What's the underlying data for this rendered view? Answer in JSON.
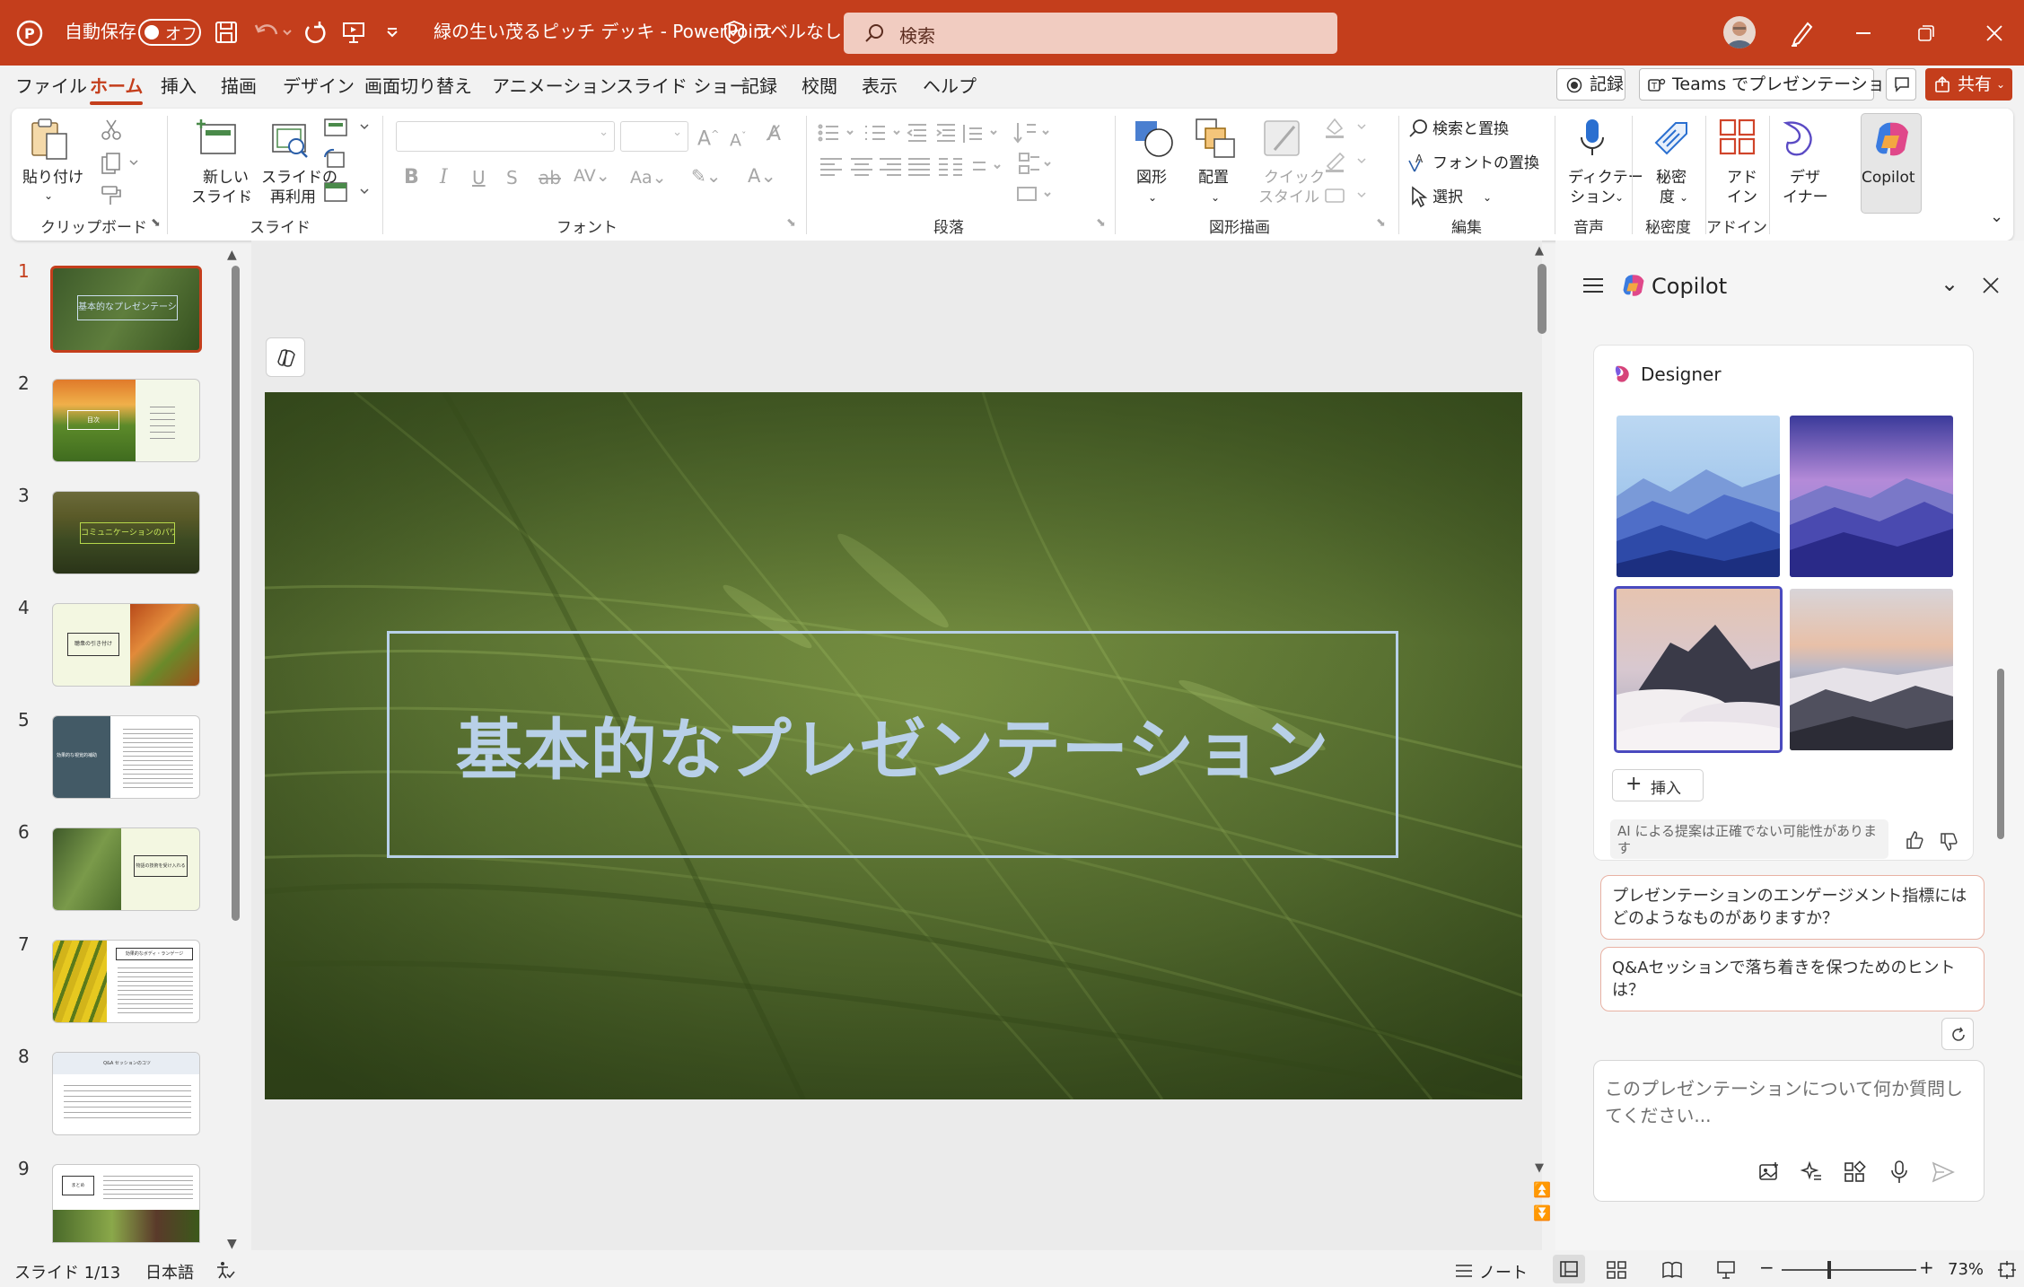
{
  "colors": {
    "accent": "#c43e1c",
    "title_text": "#b8d0e8",
    "focus": "#4a4abf"
  },
  "titlebar": {
    "autosave_label": "自動保存",
    "autosave_state": "オフ",
    "document_title": "緑の生い茂るピッチ デッキ  -  PowerPoint",
    "sensitivity_label": "ラベルなし",
    "search_placeholder": "検索"
  },
  "menu": {
    "tabs": [
      "ファイル",
      "ホーム",
      "挿入",
      "描画",
      "デザイン",
      "画面切り替え",
      "アニメーション",
      "スライド ショー",
      "記録",
      "校閲",
      "表示",
      "ヘルプ"
    ],
    "active_tab": "ホーム",
    "record_button": "記録",
    "teams_button": "Teams でプレゼンテーション",
    "share_button": "共有"
  },
  "ribbon": {
    "paste": "貼り付け",
    "new_slide_1": "新しい",
    "new_slide_2": "スライド",
    "reuse_1": "スライドの",
    "reuse_2": "再利用",
    "shapes": "図形",
    "arrange": "配置",
    "quick_styles_1": "クイック",
    "quick_styles_2": "スタイル",
    "find_replace": "検索と置換",
    "font_replace": "フォントの置換",
    "select": "選択",
    "dictate_1": "ディクテー",
    "dictate_2": "ション",
    "sensitivity_1": "秘密",
    "sensitivity_2": "度",
    "addins_1": "アド",
    "addins_2": "イン",
    "designer_1": "デザ",
    "designer_2": "イナー",
    "copilot": "Copilot",
    "groups": {
      "clipboard": "クリップボード",
      "slides": "スライド",
      "font": "フォント",
      "paragraph": "段落",
      "drawing": "図形描画",
      "editing": "編集",
      "voice": "音声",
      "sensitivity": "秘密度",
      "addins": "アドイン"
    }
  },
  "thumbnails": [
    {
      "num": "1",
      "text": "基本的なプレゼンテーション"
    },
    {
      "num": "2",
      "text": "目次"
    },
    {
      "num": "3",
      "text": "コミュニケーションのパワー"
    },
    {
      "num": "4",
      "text": "聴衆の引き付け"
    },
    {
      "num": "5",
      "text": "効果的な視覚的補助"
    },
    {
      "num": "6",
      "text": "物語の技術を受け入れる"
    },
    {
      "num": "7",
      "text": "効果的なボディ・ランゲージ"
    },
    {
      "num": "8",
      "text": "Q&A セッションのコツ"
    },
    {
      "num": "9",
      "text": "まとめ"
    }
  ],
  "slide": {
    "title": "基本的なプレゼンテーション"
  },
  "copilot": {
    "title": "Copilot",
    "designer_title": "Designer",
    "insert_button": "挿入",
    "ai_notice": "AI による提案は正確でない可能性があります",
    "suggestions": [
      "プレゼンテーションのエンゲージメント指標にはどのようなものがありますか？",
      "Q&Aセッションで落ち着きを保つためのヒントは？"
    ],
    "input_placeholder": "このプレゼンテーションについて何か質問してください..."
  },
  "status": {
    "slide_counter": "スライド 1/13",
    "language": "日本語",
    "notes": "ノート",
    "zoom": "73%"
  }
}
